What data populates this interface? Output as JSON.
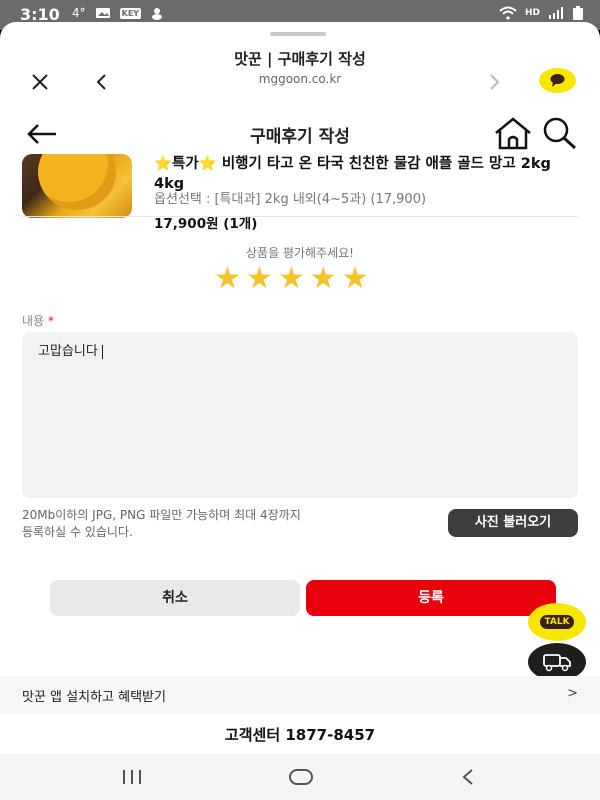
{
  "status_bar": {
    "time": "3:10",
    "temperature": "4°",
    "key_badge": "KEY",
    "hd_label": "HD"
  },
  "browser": {
    "title": "맛꾼 | 구매후기 작성",
    "url": "mggoon.co.kr"
  },
  "page": {
    "title": "구매후기 작성"
  },
  "product": {
    "name": "⭐특가⭐ 비행기 타고 온 타국 친친한 물감 애플 골드 망고 2kg 4kg",
    "option": "옵션선택 : [특대과] 2kg 내외(4~5과) (17,900)",
    "price": "17,900원 (1개)"
  },
  "rating": {
    "label": "상품을 평가해주세요!",
    "value": 5,
    "max": 5
  },
  "review": {
    "label": "내용",
    "required_mark": "*",
    "value": "고맙습니다"
  },
  "upload": {
    "notice_line1": "20Mb이하의 JPG, PNG 파일만 가능하며 최대 4장까지",
    "notice_line2": "등록하실 수 있습니다.",
    "button": "사진 불러오기"
  },
  "actions": {
    "cancel": "취소",
    "submit": "등록"
  },
  "floating": {
    "talk": "TALK"
  },
  "app_banner": {
    "text": "맛꾼 앱 설치하고 혜택받기",
    "chevron": ">"
  },
  "footer": {
    "customer_center": "고객센터 1877-8457"
  },
  "colors": {
    "accent_red": "#e8000c",
    "star_yellow": "#f7c22b",
    "kakao_yellow": "#f7e600"
  }
}
